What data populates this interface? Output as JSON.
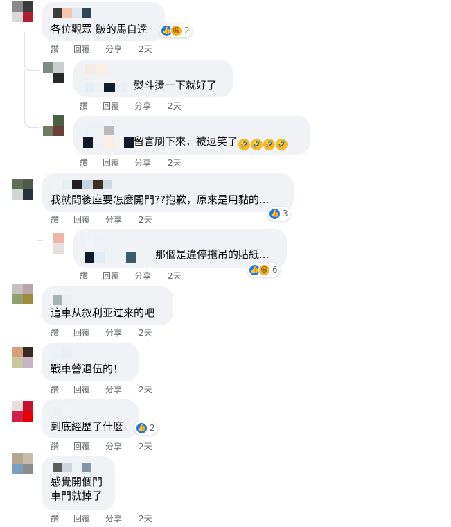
{
  "comments": [
    {
      "text": "各位觀眾 皺的馬自達",
      "reaction_count": "2",
      "reactions": [
        "like-icon",
        "haha-icon"
      ]
    },
    {
      "text": "熨斗燙一下就好了"
    },
    {
      "text": "留言刷下來，被逗笑了",
      "inline_emoji": [
        "🤣",
        "🤣",
        "🤣",
        "🤣"
      ]
    },
    {
      "text": "我就問後座要怎麼開門??抱歉，原來是用黏的...",
      "reaction_count": "3",
      "reactions": [
        "like-icon"
      ]
    },
    {
      "text": "那個是違停拖吊的貼紙...",
      "reaction_count": "6",
      "reactions": [
        "like-icon",
        "haha-icon"
      ]
    },
    {
      "text": "這車从叙利亚过来的吧"
    },
    {
      "text": "戰車營退伍的！"
    },
    {
      "text": "到底經歷了什麼",
      "reaction_count": "2",
      "reactions": [
        "like-icon"
      ]
    },
    {
      "text": "感覺開個門\n車門就掉了"
    }
  ],
  "actions": {
    "read": "讚",
    "reply": "回覆",
    "share": "分享",
    "time": "2天"
  },
  "colors": {
    "bubble": "#f0f2f5",
    "meta": "#65676b",
    "like": "#1877f2",
    "haha": "#f7b125"
  }
}
